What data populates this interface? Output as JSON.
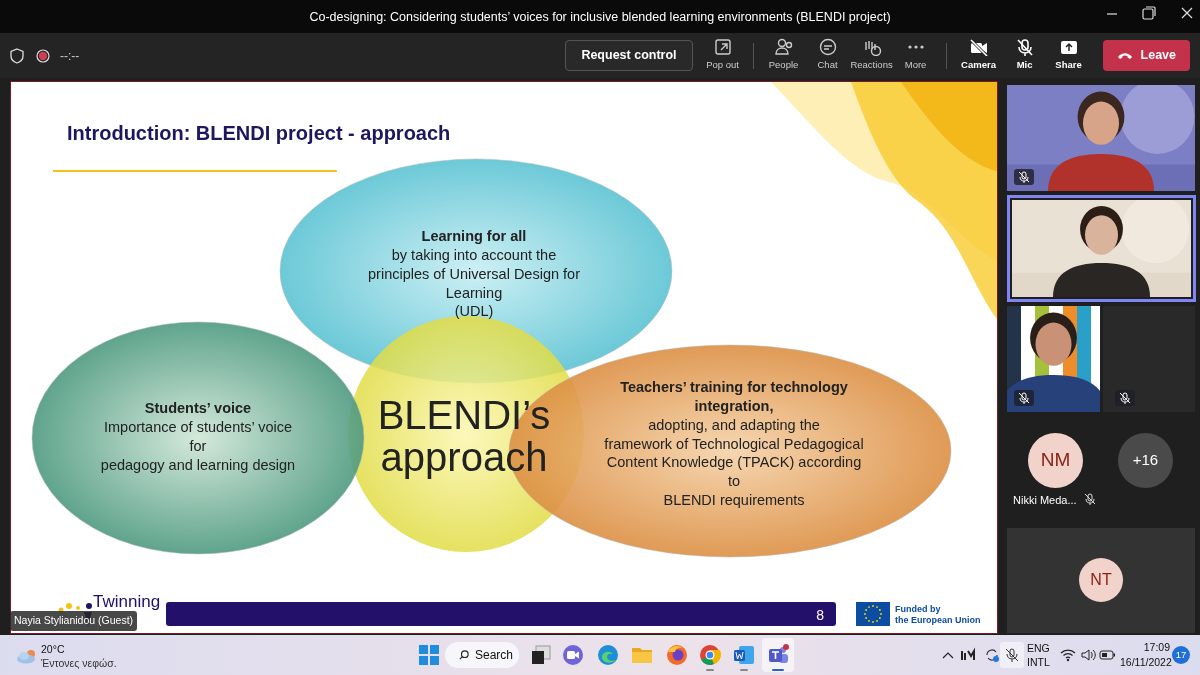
{
  "window": {
    "title": "Co-designing: Considering students’ voices for inclusive blended learning environments (BLENDI project)"
  },
  "toolbar": {
    "timer": "--:--",
    "request_control": "Request control",
    "buttons": [
      {
        "label": "Pop out",
        "kind": "popout"
      },
      {
        "label": "People",
        "kind": "people"
      },
      {
        "label": "Chat",
        "kind": "chat"
      },
      {
        "label": "Reactions",
        "kind": "reactions"
      },
      {
        "label": "More",
        "kind": "more"
      },
      {
        "label": "Camera",
        "kind": "camera_off"
      },
      {
        "label": "Mic",
        "kind": "mic_off"
      },
      {
        "label": "Share",
        "kind": "share"
      }
    ],
    "leave": "Leave"
  },
  "slide": {
    "title": "Introduction: BLENDI project - approach",
    "circles": [
      {
        "kind": "top",
        "heading": [
          "Learning for all"
        ],
        "body": [
          "by taking into account the",
          "principles of Universal Design for",
          "Learning",
          "(UDL)"
        ]
      },
      {
        "kind": "left",
        "heading": [
          "Students’ voice"
        ],
        "body": [
          "Importance of students’ voice",
          "for",
          "pedagogy and learning design"
        ]
      },
      {
        "kind": "right",
        "heading": [
          "Teachers’ training for technology",
          "integration,"
        ],
        "body": [
          "adopting, and adapting the",
          "framework of Technological Pedagogical",
          "Content Knowledge (TPACK) according",
          "to",
          "BLENDI requirements"
        ]
      }
    ],
    "center_text": [
      "BLENDI’s",
      "approach"
    ],
    "logo": "Twinning",
    "page_number": "8",
    "funding": [
      "Funded by",
      "the European Union"
    ]
  },
  "presenter_label": "Nayia Stylianidou (Guest)",
  "participants": [
    {
      "kind": "video",
      "muted": true,
      "speaking": false
    },
    {
      "kind": "video",
      "muted": false,
      "speaking": true
    },
    {
      "kind": "video",
      "muted": true,
      "speaking": false
    },
    {
      "kind": "empty",
      "muted": true,
      "speaking": false
    },
    {
      "kind": "avatar",
      "initials": "NM",
      "name": "Nikki Meda...",
      "muted": true,
      "speaking": false
    },
    {
      "kind": "overflow",
      "initials": "+16",
      "muted": false,
      "speaking": false
    },
    {
      "kind": "avatar_tile",
      "initials": "NT",
      "muted": false,
      "speaking": false
    }
  ],
  "taskbar": {
    "weather": {
      "temperature": "20°C",
      "condition": "Έντονες νεφώσ."
    },
    "search": "Search",
    "apps": [
      {
        "kind": "start",
        "running": false,
        "active": false
      },
      {
        "kind": "taskview",
        "running": false,
        "active": false
      },
      {
        "kind": "meet",
        "running": false,
        "active": false
      },
      {
        "kind": "edge",
        "running": false,
        "active": false
      },
      {
        "kind": "explorer",
        "running": false,
        "active": false
      },
      {
        "kind": "firefox",
        "running": false,
        "active": false
      },
      {
        "kind": "chrome",
        "running": true,
        "active": false
      },
      {
        "kind": "word",
        "running": true,
        "active": false
      },
      {
        "kind": "teams",
        "running": true,
        "active": true
      }
    ],
    "language": [
      "ENG",
      "INTL"
    ],
    "time": "17:09",
    "date": "16/11/2022",
    "notifications": "17"
  }
}
